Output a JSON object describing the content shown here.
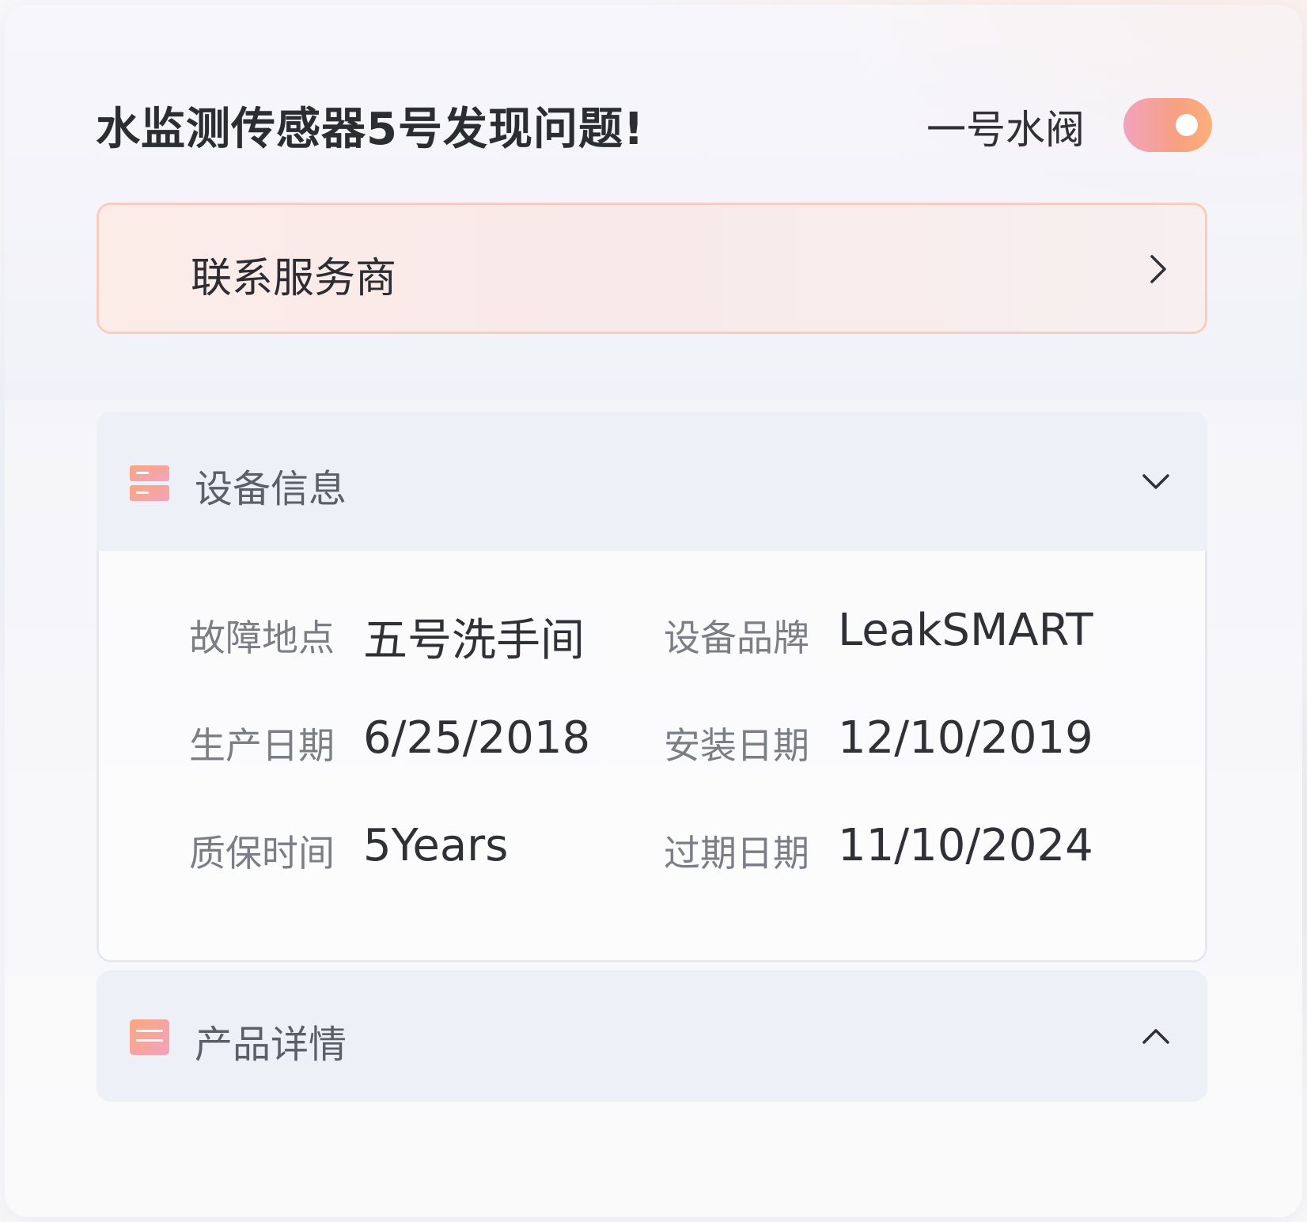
{
  "header": {
    "title": "水监测传感器5号发现问题!",
    "valve_label": "一号水阀",
    "valve_toggle_on": true
  },
  "contact": {
    "label": "联系服务商",
    "icon": "chevron-right-icon"
  },
  "device_info": {
    "title": "设备信息",
    "icon": "list-icon",
    "expand_icon": "chevron-down-icon",
    "rows": [
      {
        "label": "故障地点",
        "value": "五号洗手间"
      },
      {
        "label": "设备品牌",
        "value": "LeakSMART"
      },
      {
        "label": "生产日期",
        "value": "6/25/2018"
      },
      {
        "label": "安装日期",
        "value": "12/10/2019"
      },
      {
        "label": "质保时间",
        "value": "5Years"
      },
      {
        "label": "过期日期",
        "value": "11/10/2024"
      }
    ]
  },
  "product_details": {
    "title": "产品详情",
    "icon": "card-icon",
    "expand_icon": "chevron-up-icon"
  },
  "colors": {
    "accent_gradient_start": "#f2a3bd",
    "accent_gradient_end": "#fbb078",
    "contact_border": "#f9cdbd",
    "section_header_bg": "#eef0f7"
  }
}
